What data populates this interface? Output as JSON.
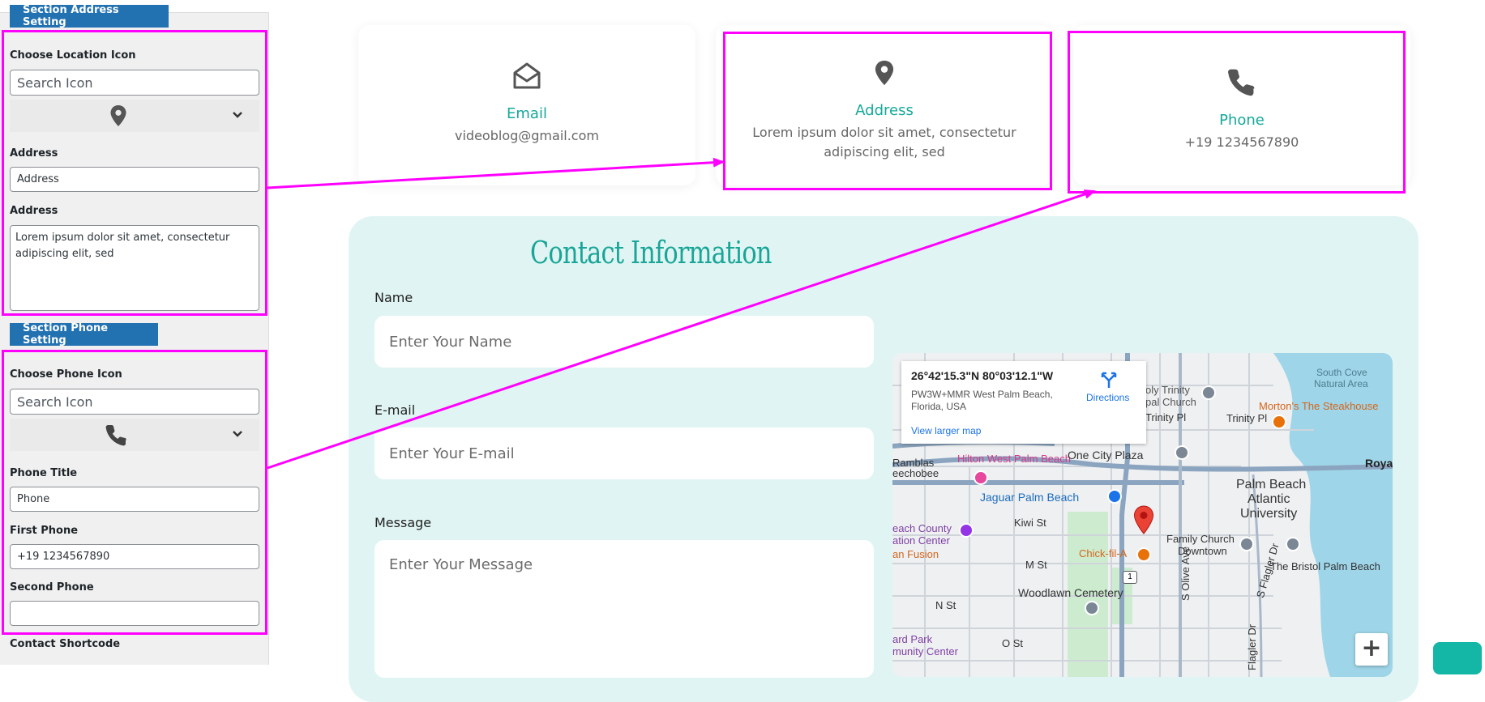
{
  "sidebar": {
    "address_section_btn": "Section Address Setting",
    "location_icon_label": "Choose Location Icon",
    "location_search_placeholder": "Search Icon",
    "address_title_label": "Address",
    "address_title_value": "Address",
    "address_text_label": "Address",
    "address_text_value": "Lorem ipsum dolor sit amet, consectetur adipiscing elit, sed",
    "phone_section_btn": "Section Phone Setting",
    "phone_icon_label": "Choose Phone Icon",
    "phone_search_placeholder": "Search Icon",
    "phone_title_label": "Phone Title",
    "phone_title_value": "Phone",
    "first_phone_label": "First Phone",
    "first_phone_value": "+19 1234567890",
    "second_phone_label": "Second Phone",
    "second_phone_value": "",
    "shortcode_label": "Contact Shortcode"
  },
  "cards": {
    "email": {
      "icon": "envelope-open-icon",
      "title": "Email",
      "text": "videoblog@gmail.com"
    },
    "address": {
      "icon": "map-pin-icon",
      "title": "Address",
      "text": "Lorem ipsum dolor sit amet, consectetur adipiscing elit, sed"
    },
    "phone": {
      "icon": "phone-icon",
      "title": "Phone",
      "text": "+19 1234567890"
    }
  },
  "contact": {
    "heading": "Contact Information",
    "name_label": "Name",
    "name_placeholder": "Enter Your Name",
    "email_label": "E-mail",
    "email_placeholder": "Enter Your E-mail",
    "message_label": "Message",
    "message_placeholder": "Enter Your Message"
  },
  "map": {
    "coords": "26°42'15.3\"N 80°03'12.1\"W",
    "address_line1": "PW3W+MMR West Palm Beach,",
    "address_line2": "Florida, USA",
    "directions": "Directions",
    "larger_map": "View larger map",
    "labels": {
      "south_cove_1": "South Cove",
      "south_cove_2": "Natural Area",
      "mortons": "Morton's The Steakhouse",
      "trinity_1": "oly Trinity",
      "trinity_2": "pal Church",
      "trinity_pl_1": "Trinity Pl",
      "trinity_pl_2": "Trinity Pl",
      "ramblas": "Ramblas",
      "hilton": "Hilton West Palm Beach",
      "eechobee": "eechobee",
      "one_city": "One City Plaza",
      "royal": "Royal",
      "pba_1": "Palm Beach",
      "pba_2": "Atlantic",
      "pba_3": "University",
      "jaguar": "Jaguar Palm Beach",
      "kiwi": "Kiwi St",
      "county_1": "each County",
      "county_2": "ation Center",
      "fusion": "an Fusion",
      "chickfila": "Chick-fil-A",
      "family_1": "Family Church",
      "family_2": "Downtown",
      "bristol": "The Bristol Palm Beach",
      "m_st": "M St",
      "n_st": "N St",
      "o_st": "O St",
      "woodlawn": "Woodlawn Cemetery",
      "olive": "S Olive Ave",
      "flagler": "S Flagler Dr",
      "flagler2": "Flagler Dr",
      "park_1": "ard Park",
      "park_2": "munity Center",
      "route": "1",
      "zoom_in": "+"
    }
  }
}
